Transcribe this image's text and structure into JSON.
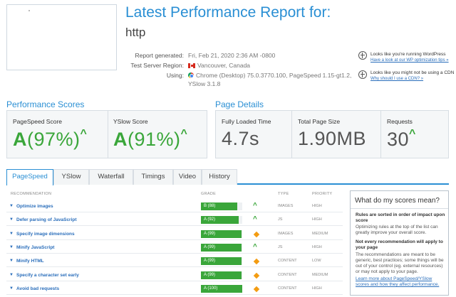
{
  "header": {
    "title": "Latest Performance Report for:",
    "url": "http",
    "meta": {
      "generated_label": "Report generated:",
      "generated_value": "Fri, Feb 21, 2020 2:36 AM -0800",
      "region_label": "Test Server Region:",
      "region_value": "Vancouver, Canada",
      "using_label": "Using:",
      "using_value_1": "Chrome (Desktop) 75.0.3770.100, PageSpeed 1.15-gt1.2,",
      "using_value_2": "YSlow 3.1.8"
    },
    "side": [
      {
        "text": "Looks like you're running WordPress",
        "link": "Have a look at our WP optimization tips »",
        "icon": "info-icon"
      },
      {
        "text": "Looks like you might not be using a CDN",
        "link": "Why should I use a CDN? »",
        "icon": "info-icon"
      }
    ]
  },
  "scores": {
    "title": "Performance Scores",
    "pagespeed": {
      "label": "PageSpeed Score",
      "grade": "A",
      "percent": "(97%)"
    },
    "yslow": {
      "label": "YSlow Score",
      "grade": "A",
      "percent": "(91%)"
    }
  },
  "details": {
    "title": "Page Details",
    "load_time": {
      "label": "Fully Loaded Time",
      "value": "4.7s"
    },
    "page_size": {
      "label": "Total Page Size",
      "value": "1.90MB"
    },
    "requests": {
      "label": "Requests",
      "value": "30"
    }
  },
  "tabs": [
    "PageSpeed",
    "YSlow",
    "Waterfall",
    "Timings",
    "Video",
    "History"
  ],
  "active_tab": "PageSpeed",
  "table": {
    "headers": {
      "recommendation": "RECOMMENDATION",
      "grade": "GRADE",
      "type": "TYPE",
      "priority": "PRIORITY"
    },
    "rows": [
      {
        "name": "Optimize images",
        "grade": "B (88)",
        "score": 88,
        "trend": "up",
        "type": "IMAGES",
        "priority": "HIGH"
      },
      {
        "name": "Defer parsing of JavaScript",
        "grade": "A (92)",
        "score": 92,
        "trend": "up",
        "type": "JS",
        "priority": "HIGH"
      },
      {
        "name": "Specify image dimensions",
        "grade": "A (99)",
        "score": 99,
        "trend": "neutral",
        "type": "IMAGES",
        "priority": "MEDIUM"
      },
      {
        "name": "Minify JavaScript",
        "grade": "A (99)",
        "score": 99,
        "trend": "up",
        "type": "JS",
        "priority": "HIGH"
      },
      {
        "name": "Minify HTML",
        "grade": "A (99)",
        "score": 99,
        "trend": "neutral",
        "type": "CONTENT",
        "priority": "LOW"
      },
      {
        "name": "Specify a character set early",
        "grade": "A (99)",
        "score": 99,
        "trend": "neutral",
        "type": "CONTENT",
        "priority": "MEDIUM"
      },
      {
        "name": "Avoid bad requests",
        "grade": "A (100)",
        "score": 100,
        "trend": "neutral",
        "type": "CONTENT",
        "priority": "HIGH"
      }
    ]
  },
  "help": {
    "title": "What do my scores mean?",
    "bold1": "Rules are sorted in order of impact upon score",
    "text1": "Optimizing rules at the top of the list can greatly improve your overall score.",
    "bold2": "Not every recommendation will apply to your page",
    "text2": "The recommendations are meant to be generic, best practices; some things will be out of your control (eg. external resources) or may not apply to your page.",
    "link": "Learn more about PageSpeed/YSlow scores and how they affect performance."
  },
  "colors": {
    "accent": "#2a8fd4",
    "grade_green": "#3aa63a",
    "neutral_orange": "#f39c12"
  }
}
